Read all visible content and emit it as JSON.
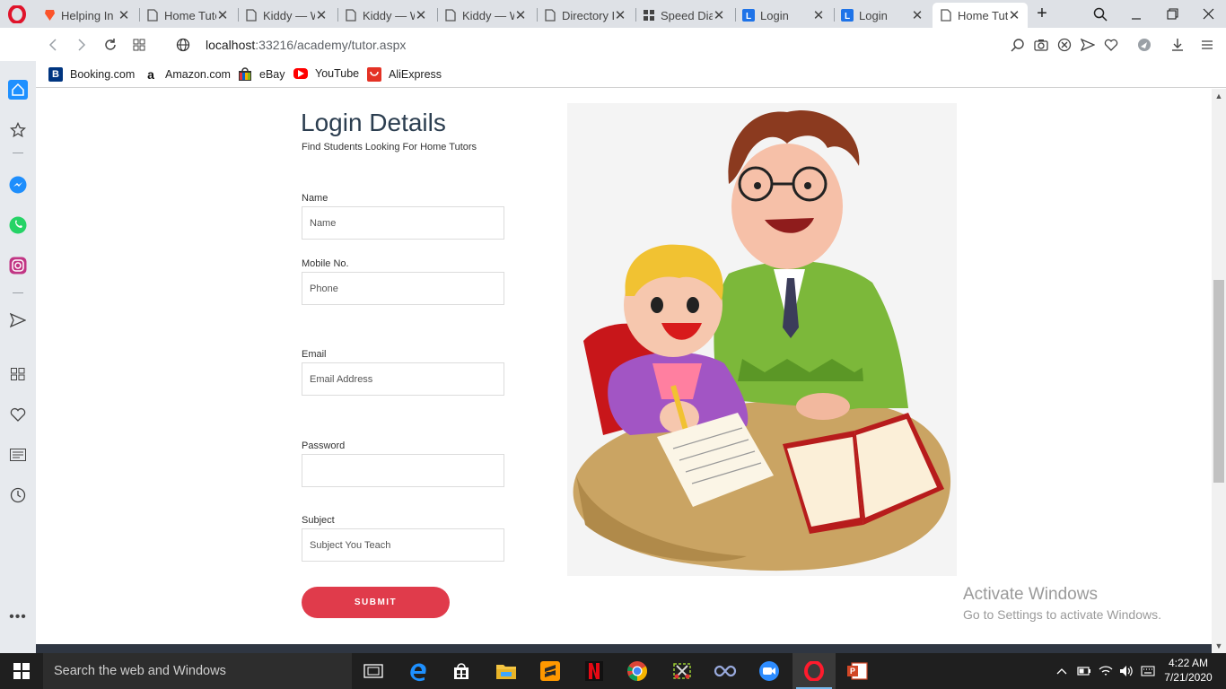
{
  "browser": {
    "tabs": [
      {
        "title": "Helping In",
        "icon": "brave-icon"
      },
      {
        "title": "Home Tuto",
        "icon": "page-icon"
      },
      {
        "title": "Kiddy — W",
        "icon": "page-icon"
      },
      {
        "title": "Kiddy — W",
        "icon": "page-icon"
      },
      {
        "title": "Kiddy — W",
        "icon": "page-icon"
      },
      {
        "title": "Directory L",
        "icon": "page-icon"
      },
      {
        "title": "Speed Dial",
        "icon": "speed-dial-icon"
      },
      {
        "title": "Login",
        "icon": "l-icon"
      },
      {
        "title": "Login",
        "icon": "l-icon"
      },
      {
        "title": "Home Tuto",
        "icon": "page-icon",
        "active": true
      }
    ],
    "new_tab": "+",
    "url_host": "localhost",
    "url_rest": ":33216/academy/tutor.aspx",
    "bookmarks": [
      {
        "label": "Booking.com",
        "icon": "booking-icon"
      },
      {
        "label": "Amazon.com",
        "icon": "amazon-icon"
      },
      {
        "label": "eBay",
        "icon": "ebay-icon"
      },
      {
        "label": "YouTube",
        "icon": "youtube-icon"
      },
      {
        "label": "AliExpress",
        "icon": "aliexpress-icon"
      }
    ]
  },
  "form": {
    "title": "Login Details",
    "subtitle": "Find Students Looking For Home Tutors",
    "name_label": "Name",
    "name_placeholder": "Name",
    "mobile_label": "Mobile No.",
    "mobile_placeholder": "Phone",
    "email_label": "Email",
    "email_placeholder": "Email Address",
    "password_label": "Password",
    "password_placeholder": "",
    "subject_label": "Subject",
    "subject_placeholder": "Subject You Teach",
    "submit_label": "SUBMIT"
  },
  "watermark": {
    "title": "Activate Windows",
    "subtitle": "Go to Settings to activate Windows."
  },
  "taskbar": {
    "search_placeholder": "Search the web and Windows",
    "time": "4:22 AM",
    "date": "7/21/2020"
  },
  "colors": {
    "accent": "#e03b4b",
    "title": "#2c3e50",
    "tab_bar": "#dee1e6",
    "sidebar": "#e7eaee",
    "taskbar": "#1f1f1f"
  }
}
